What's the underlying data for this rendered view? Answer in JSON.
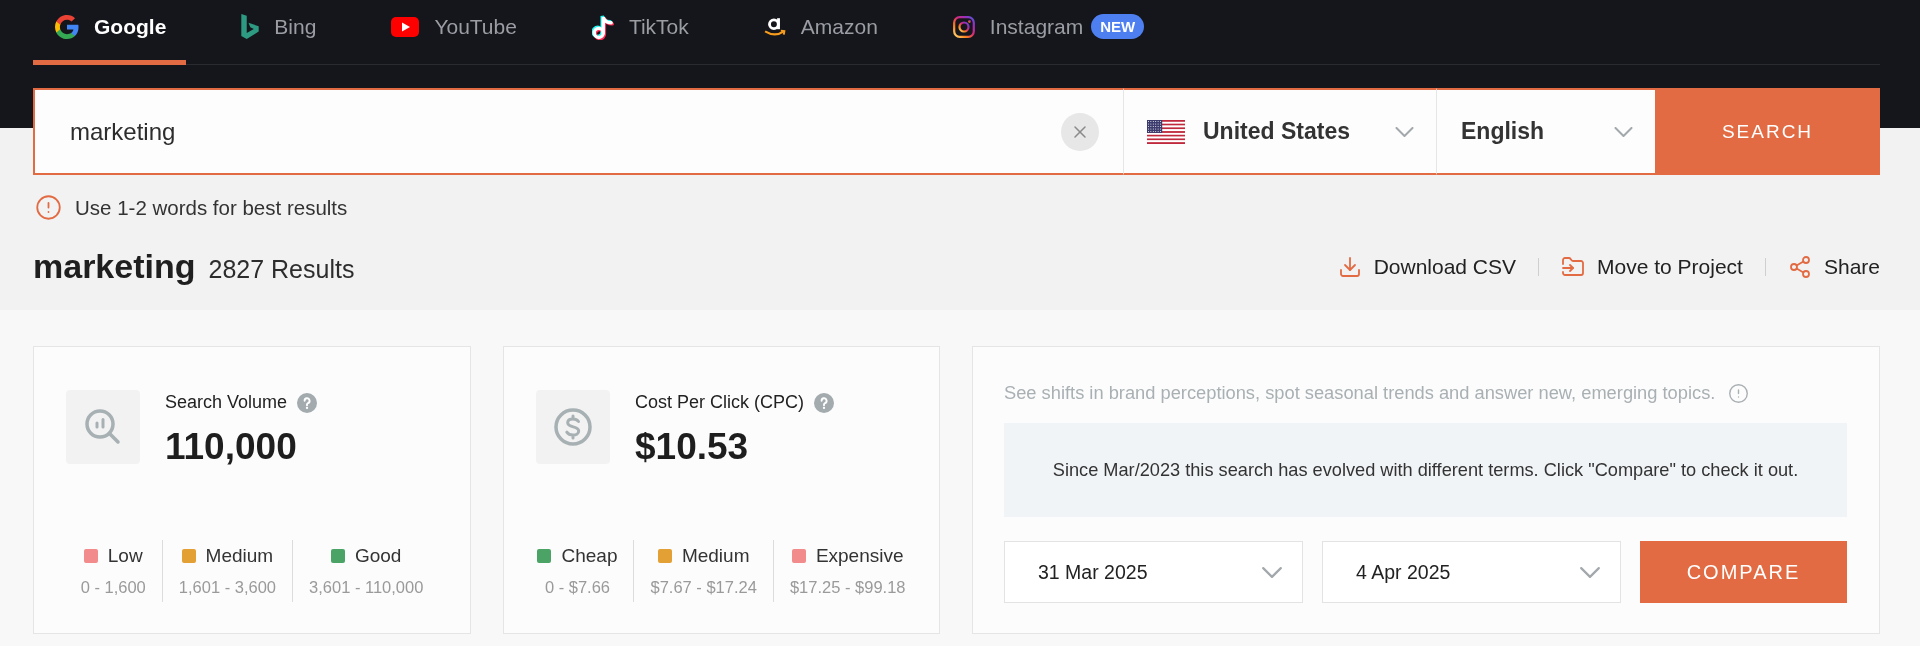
{
  "engine_tabs": [
    {
      "kind": "google",
      "label": "Google",
      "selected": true
    },
    {
      "kind": "bing",
      "label": "Bing",
      "selected": false
    },
    {
      "kind": "youtube",
      "label": "YouTube",
      "selected": false
    },
    {
      "kind": "tiktok",
      "label": "TikTok",
      "selected": false
    },
    {
      "kind": "amazon",
      "label": "Amazon",
      "selected": false
    },
    {
      "kind": "instagram",
      "label": "Instagram",
      "selected": false,
      "badge": "NEW"
    }
  ],
  "search": {
    "value": "marketing",
    "country": "United States",
    "language": "English",
    "button": "SEARCH"
  },
  "hint": "Use 1-2 words for best results",
  "results": {
    "keyword": "marketing",
    "count": "2827 Results"
  },
  "actions": [
    {
      "kind": "download",
      "label": "Download CSV"
    },
    {
      "kind": "move",
      "label": "Move to Project"
    },
    {
      "kind": "share",
      "label": "Share"
    }
  ],
  "metric_cards": [
    {
      "kind": "volume",
      "title": "Search Volume",
      "value": "110,000",
      "legend": [
        {
          "label": "Low",
          "range": "0 - 1,600",
          "color": "#f28b8b"
        },
        {
          "label": "Medium",
          "range": "1,601 - 3,600",
          "color": "#e3a035"
        },
        {
          "label": "Good",
          "range": "3,601 - 110,000",
          "color": "#4ba466"
        }
      ]
    },
    {
      "kind": "cpc",
      "title": "Cost Per Click (CPC)",
      "value": "$10.53",
      "legend": [
        {
          "label": "Cheap",
          "range": "0 - $7.66",
          "color": "#4ba466"
        },
        {
          "label": "Medium",
          "range": "$7.67 - $17.24",
          "color": "#e3a035"
        },
        {
          "label": "Expensive",
          "range": "$17.25 - $99.18",
          "color": "#f28b8b"
        }
      ]
    }
  ],
  "trends_card": {
    "description": "See shifts in brand perceptions, spot seasonal trends and answer new, emerging topics.",
    "notice": "Since Mar/2023 this search has evolved with different terms. Click \"Compare\" to check it out.",
    "date_from": "31 Mar 2025",
    "date_to": "4 Apr 2025",
    "button": "COMPARE"
  }
}
